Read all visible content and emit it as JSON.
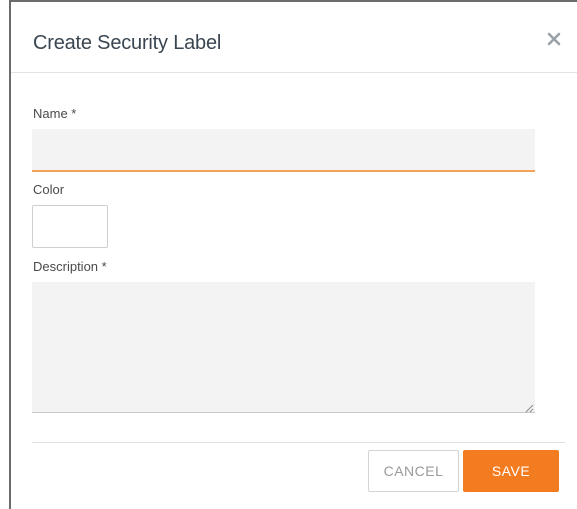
{
  "dialog": {
    "title": "Create Security Label",
    "close_icon": "close-icon"
  },
  "form": {
    "name_label": "Name *",
    "name_value": "",
    "color_label": "Color",
    "color_value": "#ffffff",
    "description_label": "Description *",
    "description_value": ""
  },
  "footer": {
    "cancel_label": "CANCEL",
    "save_label": "SAVE"
  },
  "colors": {
    "accent": "#f47c20",
    "input_focus_underline": "#f6a35a",
    "input_background": "#f3f3f3",
    "title_text": "#3a4651"
  }
}
